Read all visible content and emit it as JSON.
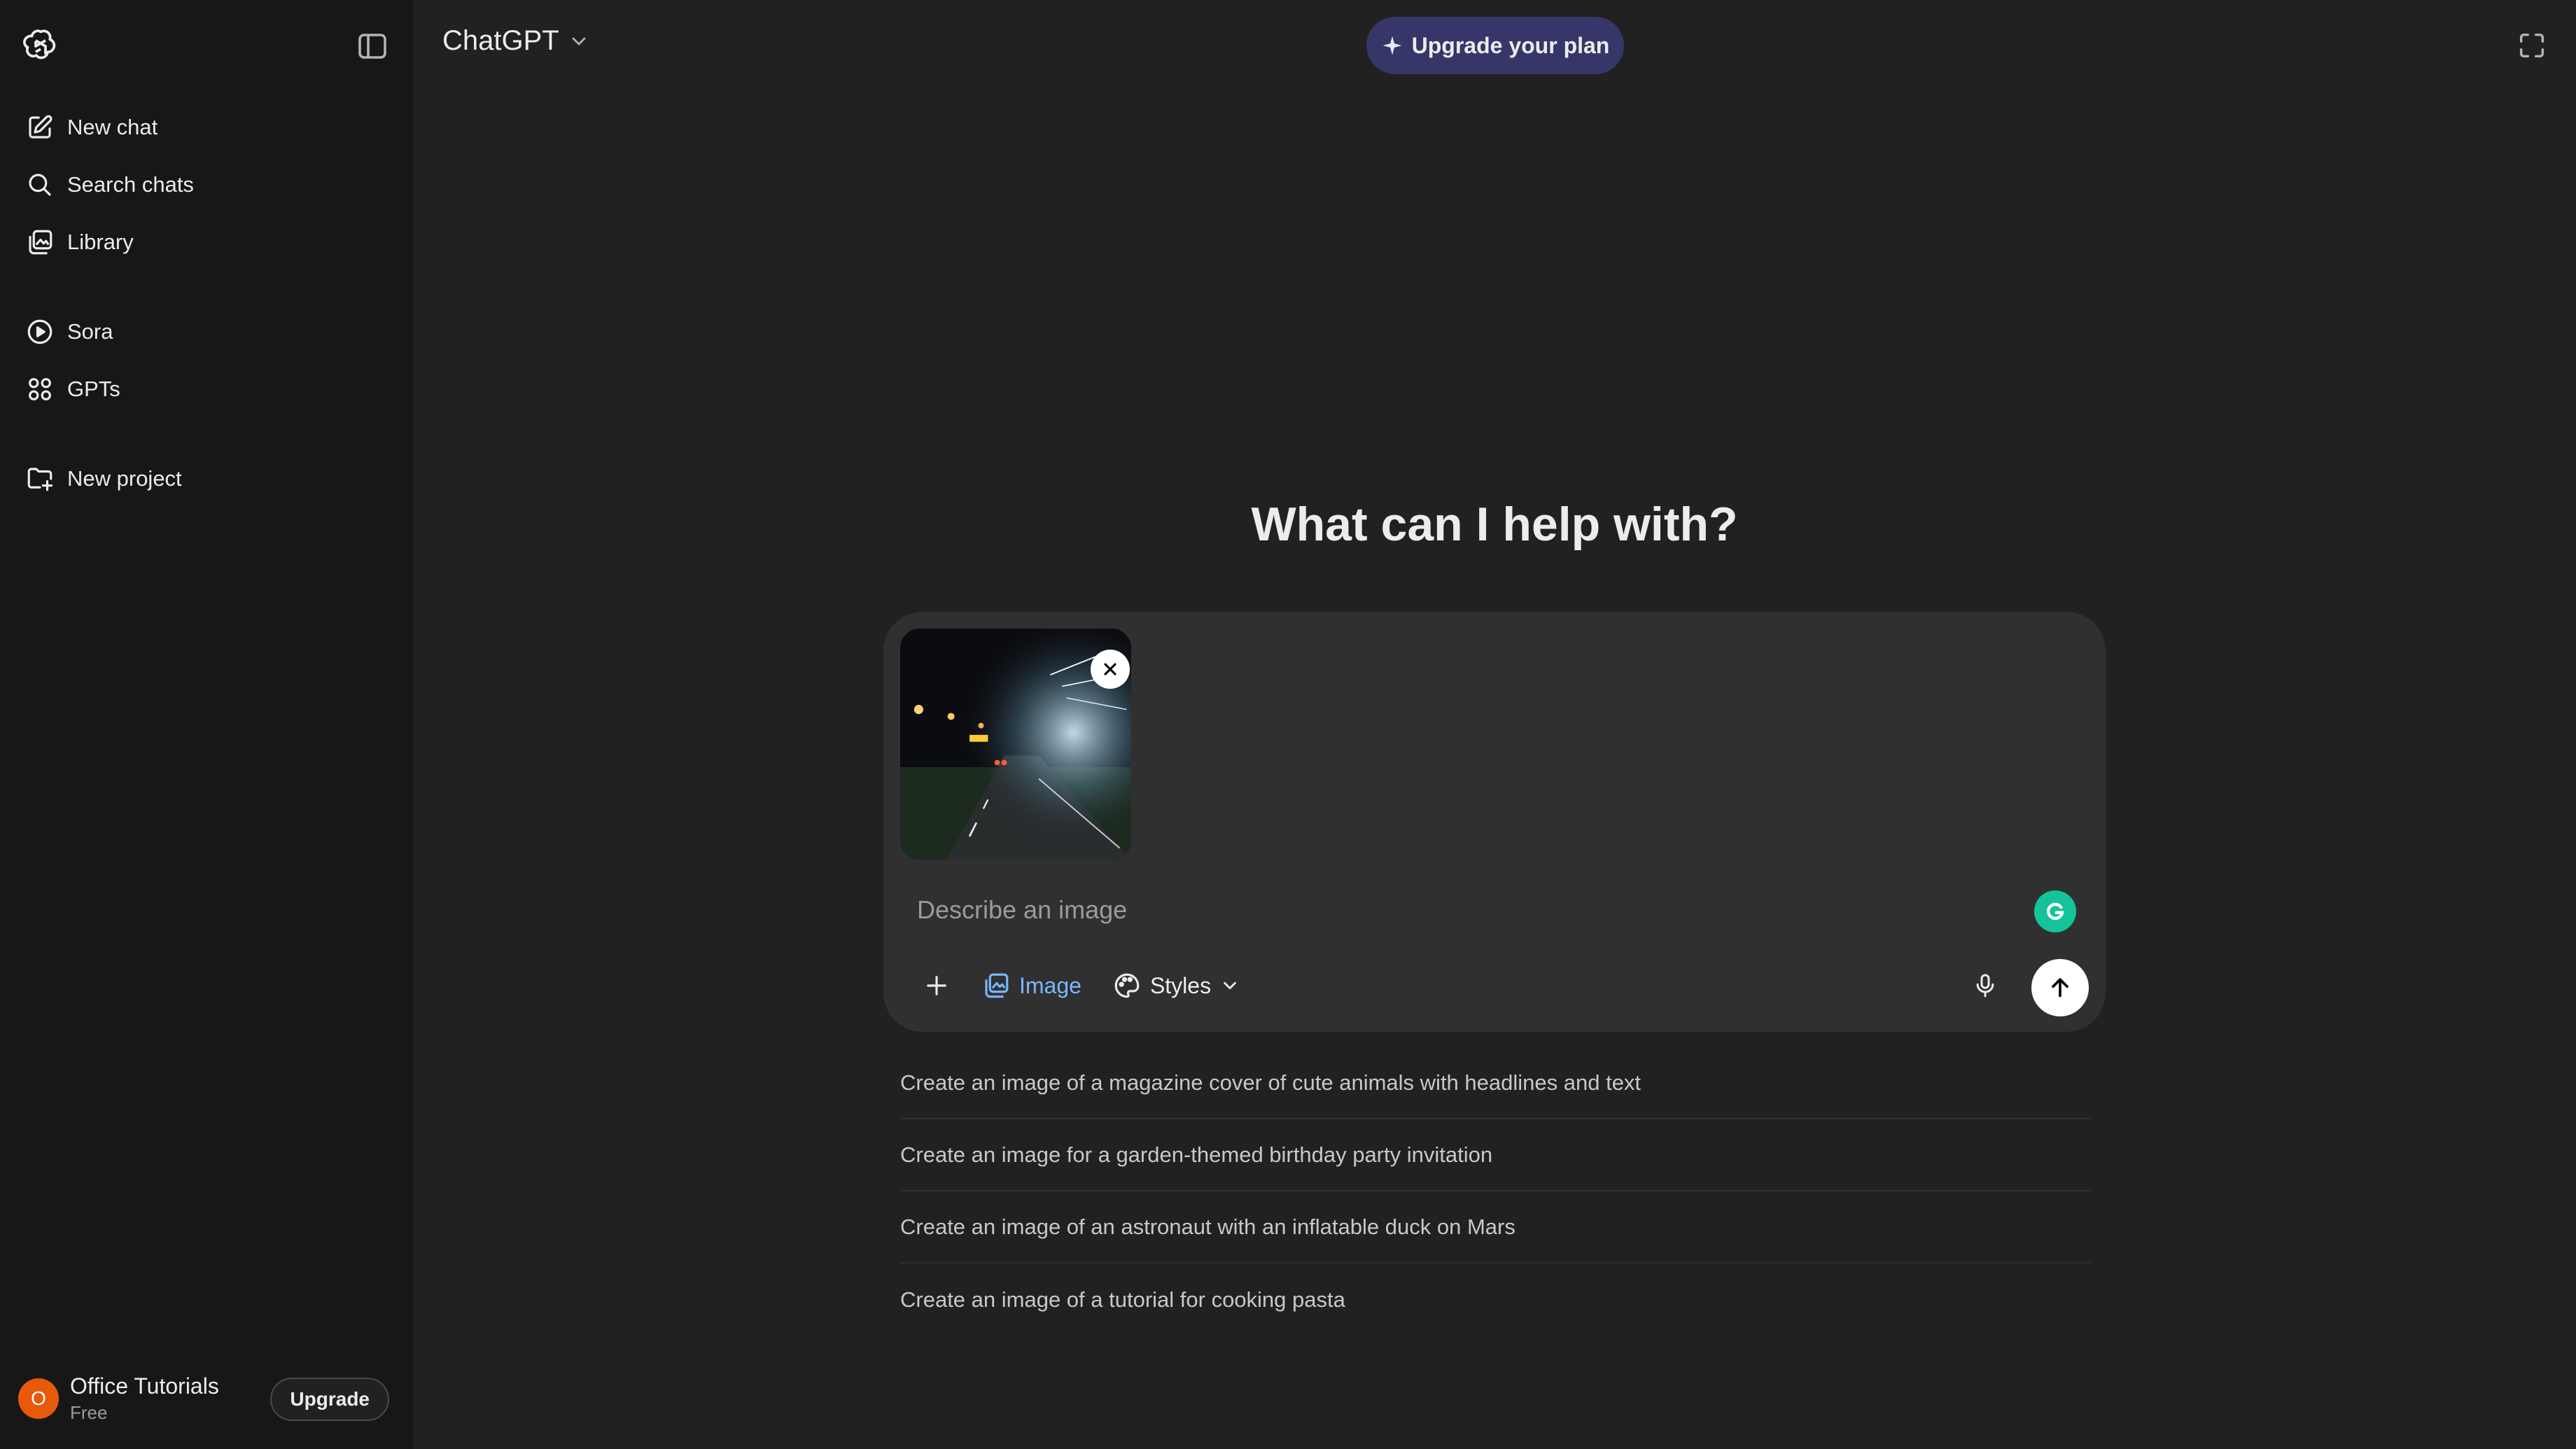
{
  "sidebar": {
    "items": [
      {
        "label": "New chat",
        "icon": "compose-icon"
      },
      {
        "label": "Search chats",
        "icon": "search-icon"
      },
      {
        "label": "Library",
        "icon": "library-icon"
      },
      {
        "label": "Sora",
        "icon": "play-circle-icon"
      },
      {
        "label": "GPTs",
        "icon": "grid-icon"
      },
      {
        "label": "New project",
        "icon": "folder-plus-icon"
      }
    ],
    "account": {
      "initial": "O",
      "name": "Office Tutorials",
      "plan": "Free",
      "upgrade_label": "Upgrade"
    }
  },
  "header": {
    "model_name": "ChatGPT",
    "upgrade_plan_label": "Upgrade your plan"
  },
  "main": {
    "heading": "What can I help with?",
    "composer": {
      "placeholder": "Describe an image",
      "image_label": "Image",
      "styles_label": "Styles"
    },
    "suggestions": [
      "Create an image of a magazine cover of cute animals with headlines and text",
      "Create an image for a garden-themed birthday party invitation",
      "Create an image of an astronaut with an inflatable duck on Mars",
      "Create an image of a tutorial for cooking pasta"
    ]
  },
  "colors": {
    "background": "#212121",
    "sidebar": "#171717",
    "composer": "#303030",
    "upgrade_pill": "#373669",
    "accent_blue": "#7ab7ff",
    "avatar": "#e8590c"
  }
}
